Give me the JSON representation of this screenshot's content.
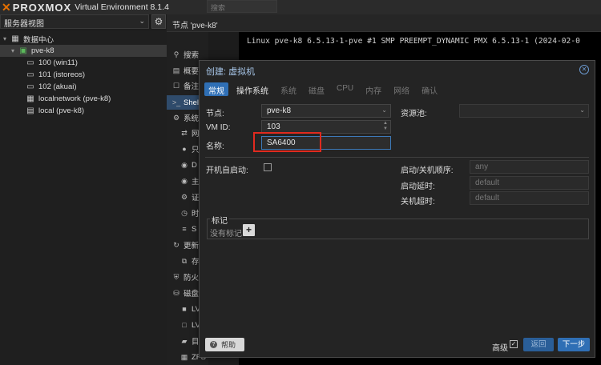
{
  "app": {
    "brand": "PROXMOX",
    "version_title": "Virtual Environment 8.1.4",
    "search_placeholder": "搜索"
  },
  "sidebar": {
    "view_select": "服务器视图",
    "tree": [
      {
        "label": "数据中心",
        "icon": "datacenter-icon"
      },
      {
        "label": "pve-k8",
        "icon": "node-icon"
      },
      {
        "label": "100 (win11)",
        "icon": "vm-icon"
      },
      {
        "label": "101 (istoreos)",
        "icon": "vm-icon"
      },
      {
        "label": "102 (akuai)",
        "icon": "vm-icon"
      },
      {
        "label": "localnetwork (pve-k8)",
        "icon": "network-icon"
      },
      {
        "label": "local (pve-k8)",
        "icon": "storage-icon"
      }
    ]
  },
  "node_header": "节点 'pve-k8'",
  "node_nav": {
    "items": [
      "搜索",
      "概要",
      "备注",
      "Shell",
      "系统",
      "网",
      "只",
      "D",
      "主",
      "证",
      "时",
      "S",
      "更新",
      "存",
      "防火",
      "磁盘",
      "LV",
      "LV",
      "目",
      "ZFS"
    ]
  },
  "console": {
    "line1": "Linux pve-k8 6.5.13-1-pve #1 SMP PREEMPT_DYNAMIC PMX 6.5.13-1 (2024-02-0"
  },
  "dialog": {
    "title": "创建: 虚拟机",
    "tabs": [
      "常规",
      "操作系统",
      "系统",
      "磁盘",
      "CPU",
      "内存",
      "网络",
      "确认"
    ],
    "node_label": "节点:",
    "node_value": "pve-k8",
    "pool_label": "资源池:",
    "vmid_label": "VM ID:",
    "vmid_value": "103",
    "name_label": "名称:",
    "name_value": "SA6400",
    "onboot_label": "开机自启动:",
    "startup_order_label": "启动/关机顺序:",
    "startup_order_placeholder": "any",
    "startup_delay_label": "启动延时:",
    "startup_delay_placeholder": "default",
    "shutdown_timeout_label": "关机超时:",
    "shutdown_timeout_placeholder": "default",
    "tags_label": "标记",
    "tags_empty": "没有标记",
    "help_label": "帮助",
    "advanced_label": "高级",
    "back_label": "返回",
    "next_label": "下一步"
  },
  "colors": {
    "accent": "#2f6fb5",
    "highlight_box": "#e02a1f",
    "logo_orange": "#e57000"
  }
}
